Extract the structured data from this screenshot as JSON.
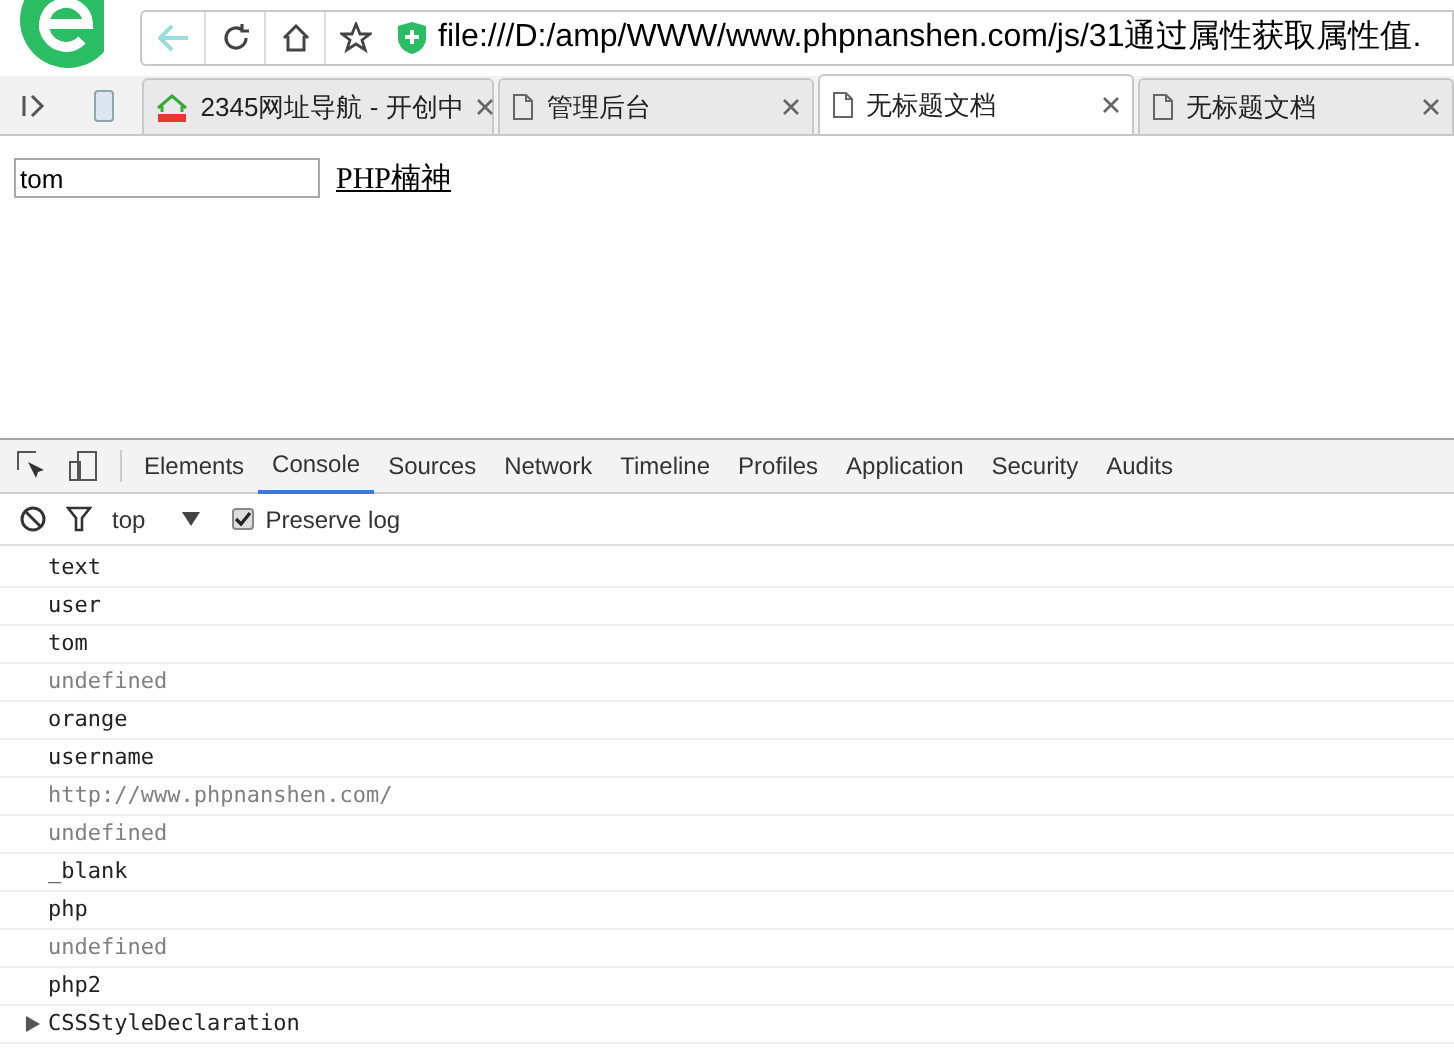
{
  "address_bar": {
    "url": "file:///D:/amp/WWW/www.phpnanshen.com/js/31通过属性获取属性值."
  },
  "tabs": [
    {
      "label": "2345网址导航 - 开创中",
      "selected": false,
      "kind": "site"
    },
    {
      "label": "管理后台",
      "selected": false,
      "kind": "page"
    },
    {
      "label": "无标题文档",
      "selected": true,
      "kind": "page"
    },
    {
      "label": "无标题文档",
      "selected": false,
      "kind": "page"
    }
  ],
  "page": {
    "input_value": "tom",
    "link": "PHP楠神"
  },
  "devtools": {
    "tabs": [
      {
        "label": "Elements",
        "selected": false
      },
      {
        "label": "Console",
        "selected": true
      },
      {
        "label": "Sources",
        "selected": false
      },
      {
        "label": "Network",
        "selected": false
      },
      {
        "label": "Timeline",
        "selected": false
      },
      {
        "label": "Profiles",
        "selected": false
      },
      {
        "label": "Application",
        "selected": false
      },
      {
        "label": "Security",
        "selected": false
      },
      {
        "label": "Audits",
        "selected": false
      }
    ],
    "context": "top",
    "preserve_log": {
      "label": "Preserve log",
      "checked": true
    },
    "console_lines": [
      {
        "text": "text",
        "kind": "log"
      },
      {
        "text": "user",
        "kind": "log"
      },
      {
        "text": "tom",
        "kind": "log"
      },
      {
        "text": "undefined",
        "kind": "undefined"
      },
      {
        "text": "orange",
        "kind": "log"
      },
      {
        "text": "username",
        "kind": "log"
      },
      {
        "text": "http://www.phpnanshen.com/",
        "kind": "undefined"
      },
      {
        "text": "undefined",
        "kind": "undefined"
      },
      {
        "text": "_blank",
        "kind": "log"
      },
      {
        "text": "php",
        "kind": "log"
      },
      {
        "text": "undefined",
        "kind": "undefined"
      },
      {
        "text": "php2",
        "kind": "log"
      },
      {
        "text": "CSSStyleDeclaration",
        "kind": "object"
      }
    ]
  }
}
